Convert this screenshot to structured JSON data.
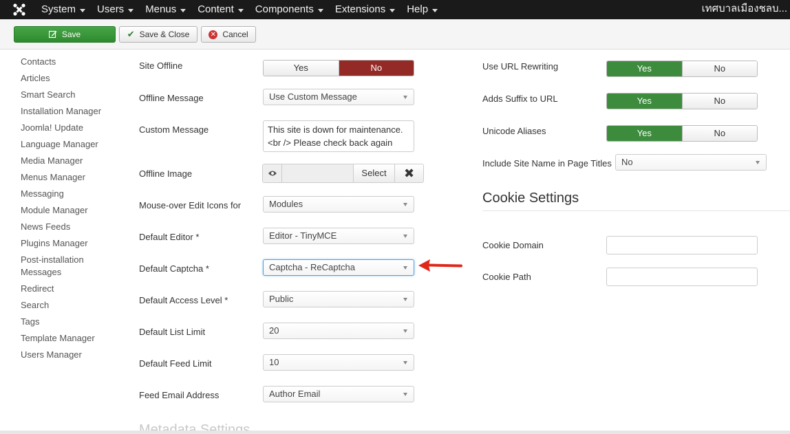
{
  "topbar": {
    "logo_icon": "joomla-logo-icon",
    "menu": [
      "System",
      "Users",
      "Menus",
      "Content",
      "Components",
      "Extensions",
      "Help"
    ],
    "site_name": "เทศบาลเมืองชลบ..."
  },
  "toolbar": {
    "save_label": "Save",
    "save_close_label": "Save & Close",
    "cancel_label": "Cancel"
  },
  "sidebar": {
    "items": [
      "Contacts",
      "Articles",
      "Smart Search",
      "Installation Manager",
      "Joomla! Update",
      "Language Manager",
      "Media Manager",
      "Menus Manager",
      "Messaging",
      "Module Manager",
      "News Feeds",
      "Plugins Manager",
      "Post-installation Messages",
      "Redirect",
      "Search",
      "Tags",
      "Template Manager",
      "Users Manager"
    ]
  },
  "site": {
    "site_offline": {
      "label": "Site Offline",
      "yes": "Yes",
      "no": "No",
      "value": "No"
    },
    "offline_message": {
      "label": "Offline Message",
      "value": "Use Custom Message"
    },
    "custom_message": {
      "label": "Custom Message",
      "value": "This site is down for maintenance.\n<br /> Please check back again"
    },
    "offline_image": {
      "label": "Offline Image",
      "select": "Select",
      "clear": "✖"
    },
    "mouseover": {
      "label": "Mouse-over Edit Icons for",
      "value": "Modules"
    },
    "default_editor": {
      "label": "Default Editor *",
      "value": "Editor - TinyMCE"
    },
    "default_captcha": {
      "label": "Default Captcha *",
      "value": "Captcha - ReCaptcha"
    },
    "access_level": {
      "label": "Default Access Level *",
      "value": "Public"
    },
    "list_limit": {
      "label": "Default List Limit",
      "value": "20"
    },
    "feed_limit": {
      "label": "Default Feed Limit",
      "value": "10"
    },
    "feed_email": {
      "label": "Feed Email Address",
      "value": "Author Email"
    },
    "metadata_title": "Metadata Settings"
  },
  "seo": {
    "url_rewriting": {
      "label": "Use URL Rewriting",
      "yes": "Yes",
      "no": "No",
      "value": "Yes"
    },
    "suffix": {
      "label": "Adds Suffix to URL",
      "yes": "Yes",
      "no": "No",
      "value": "Yes"
    },
    "unicode": {
      "label": "Unicode Aliases",
      "yes": "Yes",
      "no": "No",
      "value": "Yes"
    },
    "site_name_titles": {
      "label": "Include Site Name in Page Titles",
      "value": "No"
    }
  },
  "cookie": {
    "title": "Cookie Settings",
    "domain": {
      "label": "Cookie Domain",
      "value": ""
    },
    "path": {
      "label": "Cookie Path",
      "value": ""
    }
  },
  "colors": {
    "topbar": "#1a1a1a",
    "save_green": "#3e993e",
    "toggle_red": "#942a25",
    "toggle_green": "#3d8b3d",
    "annotation_arrow": "#e0281a"
  }
}
